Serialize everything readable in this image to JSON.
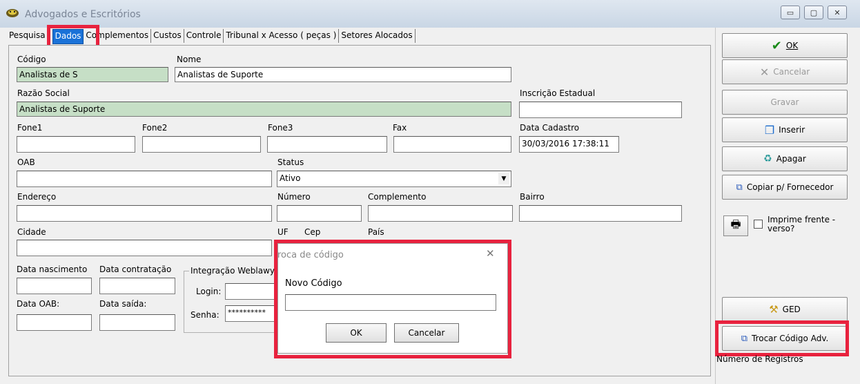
{
  "window": {
    "title": "Advogados e Escritórios",
    "minimize_glyph": "▭",
    "maximize_glyph": "▢",
    "close_glyph": "✕"
  },
  "tabs": [
    {
      "label": "Pesquisa"
    },
    {
      "label": "Dados"
    },
    {
      "label": "Complementos"
    },
    {
      "label": "Custos"
    },
    {
      "label": "Controle"
    },
    {
      "label": "Tribunal x Acesso ( peças )"
    },
    {
      "label": "Setores Alocados"
    }
  ],
  "form": {
    "codigo_label": "Código",
    "codigo_value": "Analistas de S",
    "nome_label": "Nome",
    "nome_value": "Analistas de Suporte",
    "razao_label": "Razão Social",
    "razao_value": "Analistas de Suporte",
    "inscricao_label": "Inscrição Estadual",
    "fone1_label": "Fone1",
    "fone2_label": "Fone2",
    "fone3_label": "Fone3",
    "fax_label": "Fax",
    "data_cadastro_label": "Data Cadastro",
    "data_cadastro_value": "30/03/2016 17:38:11",
    "oab_label": "OAB",
    "status_label": "Status",
    "status_value": "Ativo",
    "endereco_label": "Endereço",
    "numero_label": "Número",
    "complemento_label": "Complemento",
    "bairro_label": "Bairro",
    "cidade_label": "Cidade",
    "uf_label": "UF",
    "cep_label": "Cep",
    "pais_label": "País",
    "data_nascimento_label": "Data nascimento",
    "data_contratacao_label": "Data contratação",
    "data_oab_label": "Data OAB:",
    "data_saida_label": "Data saída:",
    "integracao_label": "Integração Weblawy",
    "login_label": "Login:",
    "senha_label": "Senha:",
    "senha_value": "**********"
  },
  "dialog": {
    "title": "roca de código",
    "close_glyph": "✕",
    "field_label": "Novo Código",
    "ok_label": "OK",
    "cancel_label": "Cancelar"
  },
  "sidebar": {
    "ok_label": "OK",
    "cancelar_label": "Cancelar",
    "gravar_label": "Gravar",
    "inserir_label": "Inserir",
    "apagar_label": "Apagar",
    "copiar_label": "Copiar p/ Fornecedor",
    "imprime_label": "Imprime frente - verso?",
    "ged_label": "GED",
    "trocar_label": "Trocar Código Adv.",
    "registros_label": "Número de Registros"
  },
  "colors": {
    "highlight": "#e8223e",
    "active_tab": "#1a72d8",
    "readonly_field": "#c6dfc6"
  }
}
